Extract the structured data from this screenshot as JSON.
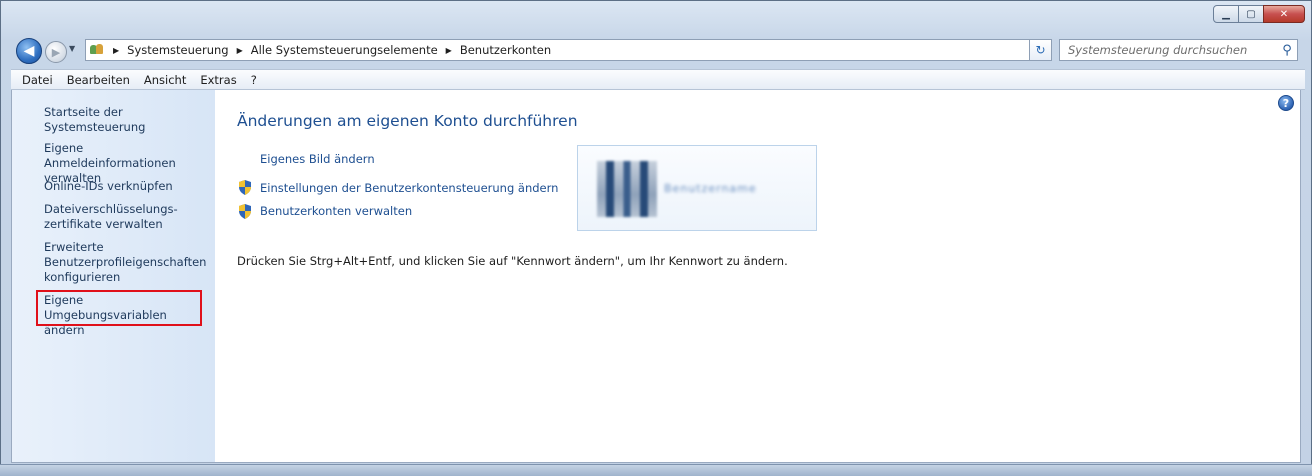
{
  "window": {
    "caption_buttons": {
      "minimize": "▁",
      "maximize": "▢",
      "close": "✕"
    }
  },
  "nav": {
    "back_icon": "◀",
    "forward_icon": "▶",
    "history_icon": "▼",
    "breadcrumbs": [
      "Systemsteuerung",
      "Alle Systemsteuerungselemente",
      "Benutzerkonten"
    ],
    "separator": "▶",
    "dropdown_icon": "▼",
    "refresh_icon": "↻",
    "search_placeholder": "Systemsteuerung durchsuchen",
    "search_icon": "⚲"
  },
  "menu": [
    "Datei",
    "Bearbeiten",
    "Ansicht",
    "Extras",
    "?"
  ],
  "sidebar": {
    "items": [
      "Startseite der Systemsteuerung",
      "Eigene Anmeldeinformationen verwalten",
      "Online-IDs verknüpfen",
      "Dateiverschlüsselungs-zertifikate verwalten",
      "Erweiterte Benutzerprofileigenschaften konfigurieren",
      "Eigene Umgebungsvariablen ändern"
    ]
  },
  "main": {
    "help_icon": "?",
    "title": "Änderungen am eigenen Konto durchführen",
    "tasks": [
      "Eigenes Bild ändern",
      "Einstellungen der Benutzerkontensteuerung ändern",
      "Benutzerkonten verwalten"
    ],
    "account_name": "Benutzername",
    "instruction": "Drücken Sie Strg+Alt+Entf, und klicken Sie auf \"Kennwort ändern\", um Ihr Kennwort zu ändern."
  },
  "colors": {
    "link": "#1e4f91",
    "sidebar_link": "#1e395b",
    "highlight_box": "#e0101a"
  }
}
